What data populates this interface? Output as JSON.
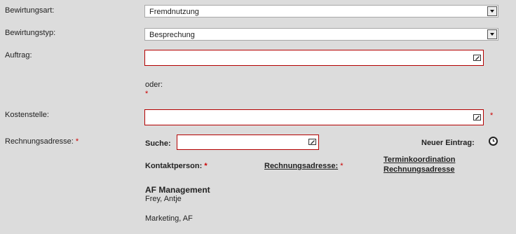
{
  "bewirtungsart": {
    "label": "Bewirtungsart:",
    "value": "Fremdnutzung"
  },
  "bewirtungstyp": {
    "label": "Bewirtungstyp:",
    "value": "Besprechung"
  },
  "auftrag": {
    "label": "Auftrag:",
    "value": ""
  },
  "oder": {
    "text": "oder:",
    "required_mark": "*"
  },
  "kostenstelle": {
    "label": "Kostenstelle:",
    "value": "",
    "required_mark": "*"
  },
  "rechnungsadresse": {
    "label": "Rechnungsadresse:",
    "required_mark": "*",
    "suche_label": "Suche:",
    "suche_value": "",
    "neuer_eintrag_label": "Neuer Eintrag:",
    "neuer_eintrag_icon": "clock-icon"
  },
  "columns": {
    "kontaktperson": {
      "label": "Kontaktperson:",
      "required_mark": "*"
    },
    "rechnungsadresse": {
      "label": "Rechnungsadresse:",
      "required_mark": "*"
    },
    "terminkoordination": {
      "line1": "Terminkoordination",
      "line2": "Rechnungsadresse"
    }
  },
  "entry": {
    "company": "AF Management",
    "person": "Frey, Antje",
    "department": "Marketing, AF"
  },
  "colors": {
    "background": "#dcdcdc",
    "required": "#cc0000",
    "field_border": "#b30000"
  }
}
